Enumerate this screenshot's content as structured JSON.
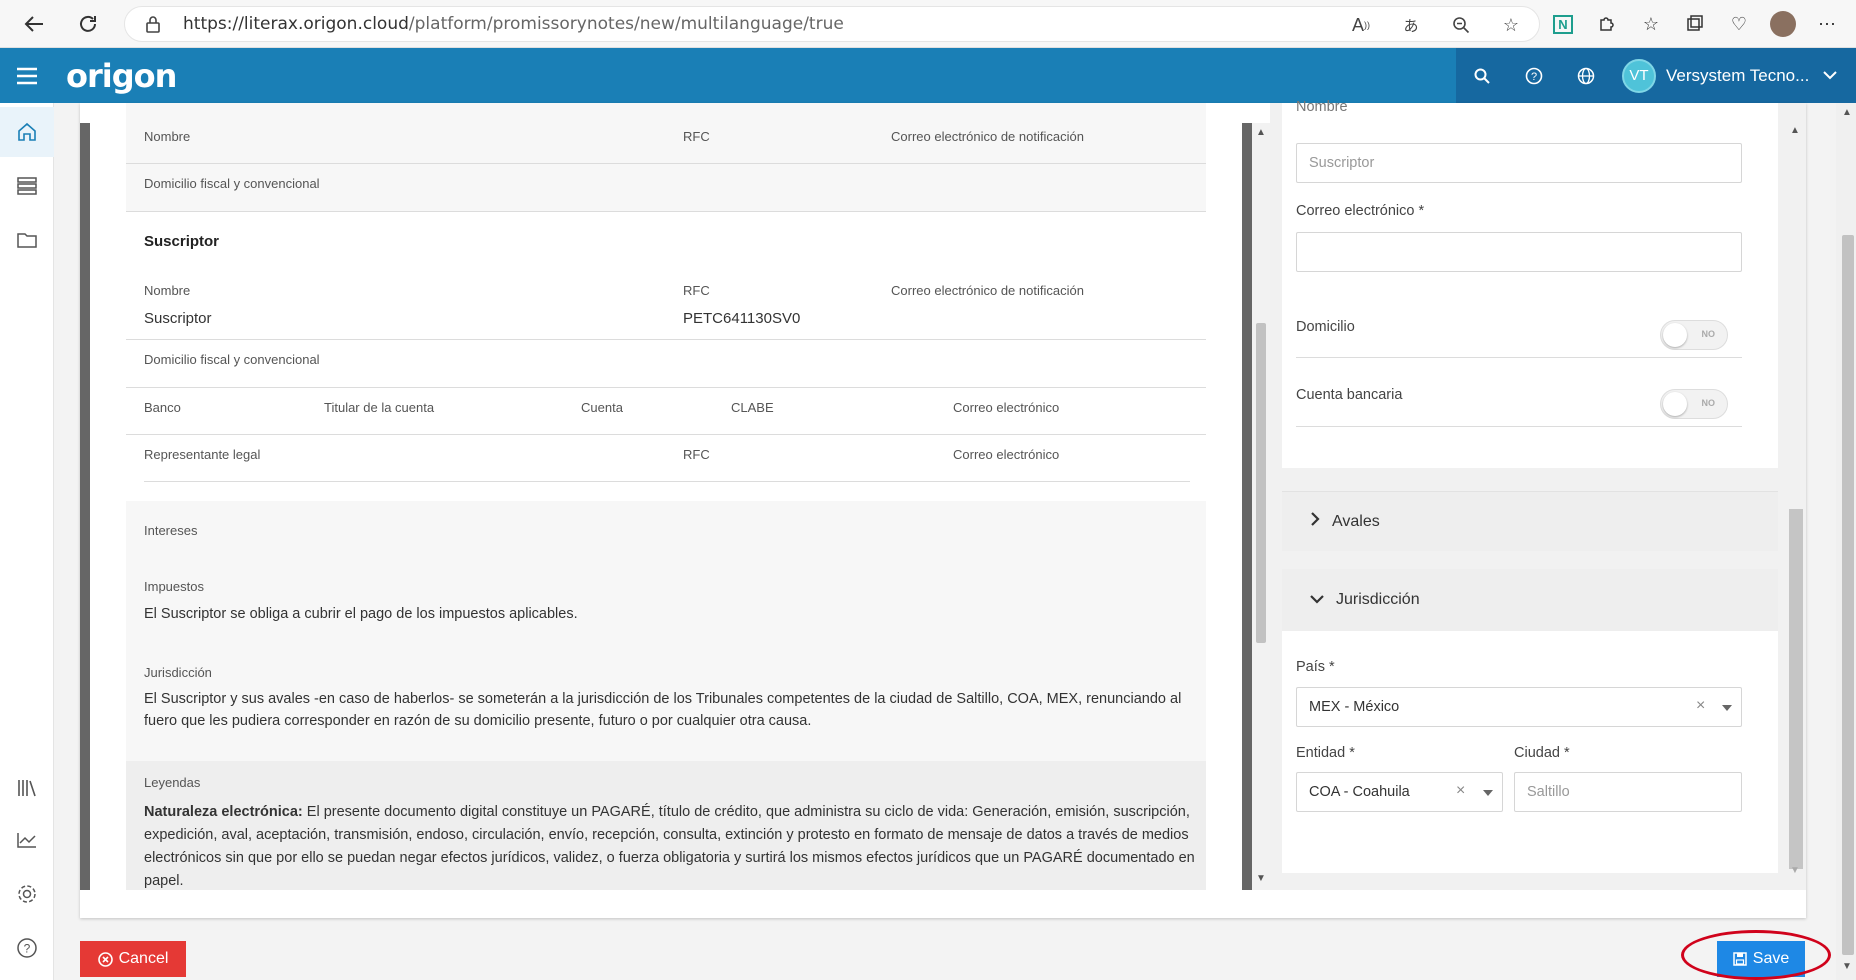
{
  "browser": {
    "url_host": "https://literax.origon.cloud",
    "url_path": "/platform/promissorynotes/new/multilanguage/true"
  },
  "app": {
    "logo": "origon",
    "user_initials": "VT",
    "user_name": "Versystem Tecno..."
  },
  "sidebar": {
    "items": [
      "home-icon",
      "list-icon",
      "folder-icon",
      "library-icon",
      "chart-icon",
      "settings-icon",
      "help-icon"
    ]
  },
  "doc": {
    "top_row": {
      "nombre": "Nombre",
      "rfc": "RFC",
      "correo": "Correo electrónico de notificación"
    },
    "domicilio1": "Domicilio fiscal y convencional",
    "suscriptor": {
      "title": "Suscriptor",
      "nombre_label": "Nombre",
      "rfc_label": "RFC",
      "correo_label": "Correo electrónico de notificación",
      "nombre_value": "Suscriptor",
      "rfc_value": "PETC641130SV0",
      "domicilio": "Domicilio fiscal y convencional"
    },
    "banco_row": {
      "banco": "Banco",
      "titular": "Titular de la cuenta",
      "cuenta": "Cuenta",
      "clabe": "CLABE",
      "correo": "Correo electrónico"
    },
    "rep_row": {
      "rep": "Representante legal",
      "rfc": "RFC",
      "correo": "Correo electrónico"
    },
    "intereses": "Intereses",
    "impuestos": {
      "label": "Impuestos",
      "text": "El Suscriptor se obliga a cubrir el pago de los impuestos aplicables."
    },
    "jurisdiccion": {
      "label": "Jurisdicción",
      "line1": "El Suscriptor y sus avales -en caso de haberlos- se someterán a la jurisdicción de los Tribunales competentes de la ciudad de Saltillo, COA, MEX, renunciando al",
      "line2": "fuero que les pudiera corresponder en razón de su domicilio presente, futuro o por cualquier otra causa."
    },
    "leyendas": {
      "label": "Leyendas",
      "bold": "Naturaleza electrónica:",
      "line1": " El presente documento digital constituye un PAGARÉ, título de crédito, que administra su ciclo de vida: Generación, emisión, suscripción,",
      "line2": "expedición, aval, aceptación, transmisión, endoso, circulación, envío, recepción, consulta, extinción y protesto en formato de mensaje de datos a través de medios",
      "line3": "electrónicos sin que por ello se puedan negar efectos jurídicos, validez, o fuerza obligatoria y surtirá los mismos efectos jurídicos que un PAGARÉ documentado en",
      "line4": "papel."
    }
  },
  "form": {
    "nombre_label_partial": "Nombre",
    "suscriptor_placeholder": "Suscriptor",
    "correo_label": "Correo electrónico *",
    "correo_value": "",
    "domicilio_label": "Domicilio",
    "domicilio_toggle": "NO",
    "cuenta_label": "Cuenta bancaria",
    "cuenta_toggle": "NO",
    "avales": "Avales",
    "jurisdiccion": "Jurisdicción",
    "pais_label": "País *",
    "pais_value": "MEX - México",
    "entidad_label": "Entidad *",
    "entidad_value": "COA - Coahuila",
    "ciudad_label": "Ciudad *",
    "ciudad_placeholder": "Saltillo"
  },
  "footer": {
    "cancel": "Cancel",
    "save": "Save"
  },
  "colors": {
    "header": "#1a7fb6",
    "cancel": "#e53935",
    "save": "#1e88e5",
    "highlight": "#d0021b"
  }
}
